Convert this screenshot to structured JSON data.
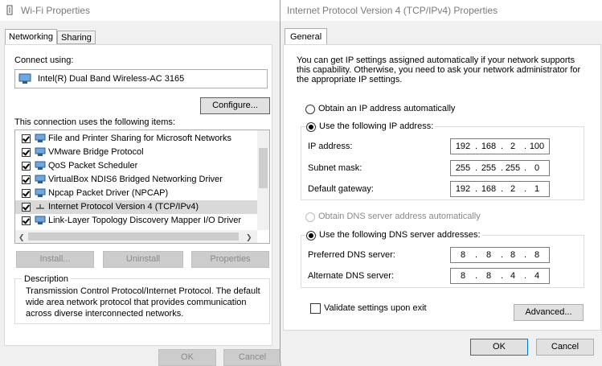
{
  "wifi": {
    "title": "Wi-Fi Properties",
    "tabs": [
      "Networking",
      "Sharing"
    ],
    "connect_using_label": "Connect using:",
    "adapter_name": "Intel(R) Dual Band Wireless-AC 3165",
    "configure_label": "Configure...",
    "items_label": "This connection uses the following items:",
    "items": [
      {
        "label": "File and Printer Sharing for Microsoft Networks",
        "checked": true
      },
      {
        "label": "VMware Bridge Protocol",
        "checked": true
      },
      {
        "label": "QoS Packet Scheduler",
        "checked": true
      },
      {
        "label": "VirtualBox NDIS6 Bridged Networking Driver",
        "checked": true
      },
      {
        "label": "Npcap Packet Driver (NPCAP)",
        "checked": true
      },
      {
        "label": "Internet Protocol Version 4 (TCP/IPv4)",
        "checked": true
      },
      {
        "label": "Link-Layer Topology Discovery Mapper I/O Driver",
        "checked": true
      }
    ],
    "install_label": "Install...",
    "uninstall_label": "Uninstall",
    "properties_label": "Properties",
    "description_label": "Description",
    "description_text": "Transmission Control Protocol/Internet Protocol. The default wide area network protocol that provides communication across diverse interconnected networks.",
    "ok_label": "OK",
    "cancel_label": "Cancel"
  },
  "ipv4": {
    "title": "Internet Protocol Version 4 (TCP/IPv4) Properties",
    "tab": "General",
    "intro": "You can get IP settings assigned automatically if your network supports this capability. Otherwise, you need to ask your network administrator for the appropriate IP settings.",
    "obtain_ip_auto": "Obtain an IP address automatically",
    "use_following_ip": "Use the following IP address:",
    "ip_address_label": "IP address:",
    "ip_address": [
      "192",
      "168",
      "2",
      "100"
    ],
    "subnet_label": "Subnet mask:",
    "subnet": [
      "255",
      "255",
      "255",
      "0"
    ],
    "gateway_label": "Default gateway:",
    "gateway": [
      "192",
      "168",
      "2",
      "1"
    ],
    "obtain_dns_auto": "Obtain DNS server address automatically",
    "use_following_dns": "Use the following DNS server addresses:",
    "preferred_dns_label": "Preferred DNS server:",
    "preferred_dns": [
      "8",
      "8",
      "8",
      "8"
    ],
    "alternate_dns_label": "Alternate DNS server:",
    "alternate_dns": [
      "8",
      "8",
      "4",
      "4"
    ],
    "validate_label": "Validate settings upon exit",
    "advanced_label": "Advanced...",
    "ok_label": "OK",
    "cancel_label": "Cancel"
  },
  "colors": {
    "accent": "#0078d7",
    "disabled_text": "#8a8a8a"
  },
  "icons": [
    "wifi-icon",
    "network-adapter-icon",
    "protocol-icon",
    "checkbox-icon",
    "radio-icon"
  ]
}
